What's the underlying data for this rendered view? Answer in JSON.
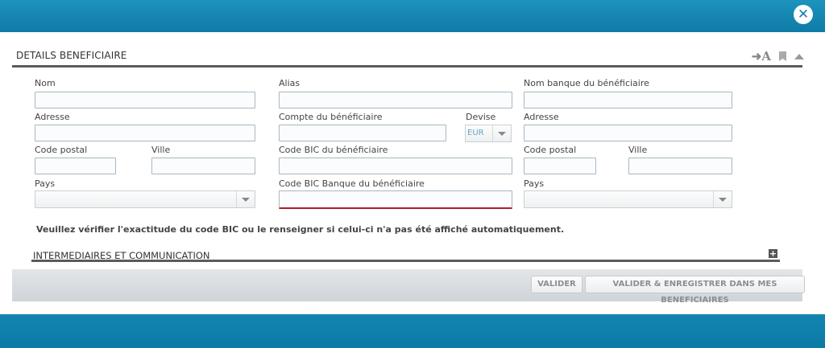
{
  "window": {
    "close_label": "✕"
  },
  "details": {
    "title": "DETAILS BENEFICIAIRE",
    "icons": [
      "translate-icon",
      "bookmark-icon",
      "collapse-up-icon"
    ]
  },
  "col1": {
    "nom_label": "Nom",
    "adresse_label": "Adresse",
    "code_postal_label": "Code postal",
    "ville_label": "Ville",
    "pays_label": "Pays",
    "pays_value": ""
  },
  "col2": {
    "alias_label": "Alias",
    "compte_label": "Compte du bénéficiaire",
    "devise_label": "Devise",
    "devise_value": "EUR",
    "bic_label": "Code BIC du bénéficiaire",
    "bic_banque_label": "Code BIC Banque du bénéficiaire"
  },
  "col3": {
    "nom_banque_label": "Nom banque du bénéficiaire",
    "adresse_label": "Adresse",
    "code_postal_label": "Code postal",
    "ville_label": "Ville",
    "pays_label": "Pays",
    "pays_value": ""
  },
  "notice": "Veuillez vérifier l'exactitude du code BIC ou le renseigner si celui-ci n'a pas été affiché automatiquement.",
  "intermediaires": {
    "title": "INTERMEDIAIRES ET COMMUNICATION",
    "expand_label": "+"
  },
  "footer": {
    "valider_label": "VALIDER",
    "valider_enregistrer_label": "VALIDER & ENREGISTRER DANS MES BENEFICIAIRES"
  }
}
